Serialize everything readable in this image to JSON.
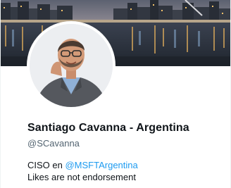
{
  "profile": {
    "display_name": "Santiago Cavanna - Argentina",
    "handle": "@SCavanna",
    "bio_prefix": "CISO en",
    "bio_mention": "@MSFTArgentina",
    "bio_line2": "Likes are not endorsement"
  },
  "banner": {
    "icon": "city-waterfront-photo"
  },
  "avatar": {
    "icon": "profile-photo"
  },
  "colors": {
    "name_text": "#0f1419",
    "handle_text": "#536471",
    "mention_link": "#1d9bf0",
    "banner_sky": "#6e6a78",
    "banner_water": "#2d3440"
  }
}
